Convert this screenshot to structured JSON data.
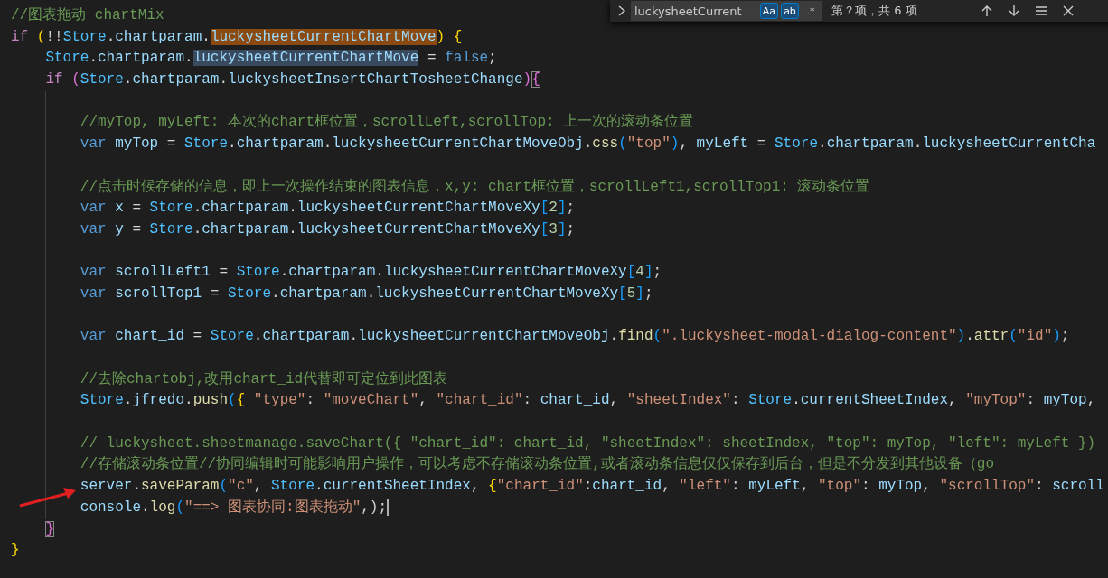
{
  "find_widget": {
    "query": "luckysheetCurrent",
    "toggles": [
      {
        "label": "Aa",
        "on": true
      },
      {
        "label": "ab",
        "on": true
      },
      {
        "label": ".*",
        "on": false
      }
    ],
    "result": "第？项，共 6 项"
  },
  "editor": {
    "lines": [
      {
        "kind": "code",
        "caret": false,
        "tokens": [
          {
            "kind": "comment",
            "text": "//图表拖动 chartMix"
          }
        ]
      },
      {
        "kind": "code",
        "caret": false,
        "tokens": [
          {
            "kind": "control",
            "text": "if "
          },
          {
            "kind": "b1",
            "text": "("
          },
          {
            "kind": "punct",
            "text": "!!"
          },
          {
            "kind": "object",
            "text": "Store"
          },
          {
            "kind": "punct",
            "text": "."
          },
          {
            "kind": "variable",
            "text": "chartparam"
          },
          {
            "kind": "punct",
            "text": "."
          },
          {
            "kind": "match",
            "text": "luckysheetCurrentChartMove"
          },
          {
            "kind": "b1",
            "text": ")"
          },
          {
            "kind": "b1",
            "text": " {"
          }
        ],
        "children": [
          {
            "kind": "code",
            "caret": false,
            "tokens": [
              {
                "kind": "object",
                "text": "Store"
              },
              {
                "kind": "punct",
                "text": "."
              },
              {
                "kind": "variable",
                "text": "chartparam"
              },
              {
                "kind": "punct",
                "text": "."
              },
              {
                "kind": "selection",
                "text": "luckysheetCurrentChartMove"
              },
              {
                "kind": "punct",
                "text": " = "
              },
              {
                "kind": "storage",
                "text": "false"
              },
              {
                "kind": "punct",
                "text": ";"
              }
            ]
          },
          {
            "kind": "code",
            "caret": false,
            "tokens": [
              {
                "kind": "control",
                "text": "if "
              },
              {
                "kind": "b2",
                "text": "("
              },
              {
                "kind": "object",
                "text": "Store"
              },
              {
                "kind": "punct",
                "text": "."
              },
              {
                "kind": "variable",
                "text": "chartparam"
              },
              {
                "kind": "punct",
                "text": "."
              },
              {
                "kind": "variable",
                "text": "luckysheetInsertChartTosheetChange"
              },
              {
                "kind": "b2",
                "text": ")"
              },
              {
                "kind": "b2box",
                "text": "{"
              }
            ],
            "children": [
              {
                "kind": "blank",
                "caret": false
              },
              {
                "kind": "code",
                "caret": false,
                "tokens": [
                  {
                    "kind": "comment",
                    "text": "//myTop, myLeft: 本次的chart框位置，scrollLeft,scrollTop: 上一次的滚动条位置"
                  }
                ]
              },
              {
                "kind": "code",
                "caret": false,
                "tokens": [
                  {
                    "kind": "storage",
                    "text": "var "
                  },
                  {
                    "kind": "variable",
                    "text": "myTop"
                  },
                  {
                    "kind": "punct",
                    "text": " = "
                  },
                  {
                    "kind": "object",
                    "text": "Store"
                  },
                  {
                    "kind": "punct",
                    "text": "."
                  },
                  {
                    "kind": "variable",
                    "text": "chartparam"
                  },
                  {
                    "kind": "punct",
                    "text": "."
                  },
                  {
                    "kind": "variable",
                    "text": "luckysheetCurrentChartMoveObj"
                  },
                  {
                    "kind": "punct",
                    "text": "."
                  },
                  {
                    "kind": "function",
                    "text": "css"
                  },
                  {
                    "kind": "b3",
                    "text": "("
                  },
                  {
                    "kind": "string",
                    "text": "\"top\""
                  },
                  {
                    "kind": "b3",
                    "text": ")"
                  },
                  {
                    "kind": "punct",
                    "text": ", "
                  },
                  {
                    "kind": "variable",
                    "text": "myLeft"
                  },
                  {
                    "kind": "punct",
                    "text": " = "
                  },
                  {
                    "kind": "object",
                    "text": "Store"
                  },
                  {
                    "kind": "punct",
                    "text": "."
                  },
                  {
                    "kind": "variable",
                    "text": "chartparam"
                  },
                  {
                    "kind": "punct",
                    "text": "."
                  },
                  {
                    "kind": "variable",
                    "text": "luckysheetCurrentCha"
                  }
                ]
              },
              {
                "kind": "blank",
                "caret": false
              },
              {
                "kind": "code",
                "caret": false,
                "tokens": [
                  {
                    "kind": "comment",
                    "text": "//点击时候存储的信息，即上一次操作结束的图表信息，x,y: chart框位置，scrollLeft1,scrollTop1: 滚动条位置"
                  }
                ]
              },
              {
                "kind": "code",
                "caret": false,
                "tokens": [
                  {
                    "kind": "storage",
                    "text": "var "
                  },
                  {
                    "kind": "variable",
                    "text": "x"
                  },
                  {
                    "kind": "punct",
                    "text": " = "
                  },
                  {
                    "kind": "object",
                    "text": "Store"
                  },
                  {
                    "kind": "punct",
                    "text": "."
                  },
                  {
                    "kind": "variable",
                    "text": "chartparam"
                  },
                  {
                    "kind": "punct",
                    "text": "."
                  },
                  {
                    "kind": "variable",
                    "text": "luckysheetCurrentChartMoveXy"
                  },
                  {
                    "kind": "b3",
                    "text": "["
                  },
                  {
                    "kind": "number",
                    "text": "2"
                  },
                  {
                    "kind": "b3",
                    "text": "]"
                  },
                  {
                    "kind": "punct",
                    "text": ";"
                  }
                ]
              },
              {
                "kind": "code",
                "caret": false,
                "tokens": [
                  {
                    "kind": "storage",
                    "text": "var "
                  },
                  {
                    "kind": "variable",
                    "text": "y"
                  },
                  {
                    "kind": "punct",
                    "text": " = "
                  },
                  {
                    "kind": "object",
                    "text": "Store"
                  },
                  {
                    "kind": "punct",
                    "text": "."
                  },
                  {
                    "kind": "variable",
                    "text": "chartparam"
                  },
                  {
                    "kind": "punct",
                    "text": "."
                  },
                  {
                    "kind": "variable",
                    "text": "luckysheetCurrentChartMoveXy"
                  },
                  {
                    "kind": "b3",
                    "text": "["
                  },
                  {
                    "kind": "number",
                    "text": "3"
                  },
                  {
                    "kind": "b3",
                    "text": "]"
                  },
                  {
                    "kind": "punct",
                    "text": ";"
                  }
                ]
              },
              {
                "kind": "blank",
                "caret": false
              },
              {
                "kind": "code",
                "caret": false,
                "tokens": [
                  {
                    "kind": "storage",
                    "text": "var "
                  },
                  {
                    "kind": "variable",
                    "text": "scrollLeft1"
                  },
                  {
                    "kind": "punct",
                    "text": " = "
                  },
                  {
                    "kind": "object",
                    "text": "Store"
                  },
                  {
                    "kind": "punct",
                    "text": "."
                  },
                  {
                    "kind": "variable",
                    "text": "chartparam"
                  },
                  {
                    "kind": "punct",
                    "text": "."
                  },
                  {
                    "kind": "variable",
                    "text": "luckysheetCurrentChartMoveXy"
                  },
                  {
                    "kind": "b3",
                    "text": "["
                  },
                  {
                    "kind": "number",
                    "text": "4"
                  },
                  {
                    "kind": "b3",
                    "text": "]"
                  },
                  {
                    "kind": "punct",
                    "text": ";"
                  }
                ]
              },
              {
                "kind": "code",
                "caret": false,
                "tokens": [
                  {
                    "kind": "storage",
                    "text": "var "
                  },
                  {
                    "kind": "variable",
                    "text": "scrollTop1"
                  },
                  {
                    "kind": "punct",
                    "text": " = "
                  },
                  {
                    "kind": "object",
                    "text": "Store"
                  },
                  {
                    "kind": "punct",
                    "text": "."
                  },
                  {
                    "kind": "variable",
                    "text": "chartparam"
                  },
                  {
                    "kind": "punct",
                    "text": "."
                  },
                  {
                    "kind": "variable",
                    "text": "luckysheetCurrentChartMoveXy"
                  },
                  {
                    "kind": "b3",
                    "text": "["
                  },
                  {
                    "kind": "number",
                    "text": "5"
                  },
                  {
                    "kind": "b3",
                    "text": "]"
                  },
                  {
                    "kind": "punct",
                    "text": ";"
                  }
                ]
              },
              {
                "kind": "blank",
                "caret": false
              },
              {
                "kind": "code",
                "caret": false,
                "tokens": [
                  {
                    "kind": "storage",
                    "text": "var "
                  },
                  {
                    "kind": "variable",
                    "text": "chart_id"
                  },
                  {
                    "kind": "punct",
                    "text": " = "
                  },
                  {
                    "kind": "object",
                    "text": "Store"
                  },
                  {
                    "kind": "punct",
                    "text": "."
                  },
                  {
                    "kind": "variable",
                    "text": "chartparam"
                  },
                  {
                    "kind": "punct",
                    "text": "."
                  },
                  {
                    "kind": "variable",
                    "text": "luckysheetCurrentChartMoveObj"
                  },
                  {
                    "kind": "punct",
                    "text": "."
                  },
                  {
                    "kind": "function",
                    "text": "find"
                  },
                  {
                    "kind": "b3",
                    "text": "("
                  },
                  {
                    "kind": "string",
                    "text": "\".luckysheet-modal-dialog-content\""
                  },
                  {
                    "kind": "b3",
                    "text": ")"
                  },
                  {
                    "kind": "punct",
                    "text": "."
                  },
                  {
                    "kind": "function",
                    "text": "attr"
                  },
                  {
                    "kind": "b3",
                    "text": "("
                  },
                  {
                    "kind": "string",
                    "text": "\"id\""
                  },
                  {
                    "kind": "b3",
                    "text": ")"
                  },
                  {
                    "kind": "punct",
                    "text": ";"
                  }
                ]
              },
              {
                "kind": "blank",
                "caret": false
              },
              {
                "kind": "code",
                "caret": false,
                "tokens": [
                  {
                    "kind": "comment",
                    "text": "//去除chartobj,改用chart_id代替即可定位到此图表"
                  }
                ]
              },
              {
                "kind": "code",
                "caret": false,
                "tokens": [
                  {
                    "kind": "object",
                    "text": "Store"
                  },
                  {
                    "kind": "punct",
                    "text": "."
                  },
                  {
                    "kind": "variable",
                    "text": "jfredo"
                  },
                  {
                    "kind": "punct",
                    "text": "."
                  },
                  {
                    "kind": "function",
                    "text": "push"
                  },
                  {
                    "kind": "b3",
                    "text": "("
                  },
                  {
                    "kind": "b1",
                    "text": "{ "
                  },
                  {
                    "kind": "string",
                    "text": "\"type\""
                  },
                  {
                    "kind": "punct",
                    "text": ": "
                  },
                  {
                    "kind": "string",
                    "text": "\"moveChart\""
                  },
                  {
                    "kind": "punct",
                    "text": ", "
                  },
                  {
                    "kind": "string",
                    "text": "\"chart_id\""
                  },
                  {
                    "kind": "punct",
                    "text": ": "
                  },
                  {
                    "kind": "variable",
                    "text": "chart_id"
                  },
                  {
                    "kind": "punct",
                    "text": ", "
                  },
                  {
                    "kind": "string",
                    "text": "\"sheetIndex\""
                  },
                  {
                    "kind": "punct",
                    "text": ": "
                  },
                  {
                    "kind": "object",
                    "text": "Store"
                  },
                  {
                    "kind": "punct",
                    "text": "."
                  },
                  {
                    "kind": "variable",
                    "text": "currentSheetIndex"
                  },
                  {
                    "kind": "punct",
                    "text": ", "
                  },
                  {
                    "kind": "string",
                    "text": "\"myTop\""
                  },
                  {
                    "kind": "punct",
                    "text": ": "
                  },
                  {
                    "kind": "variable",
                    "text": "myTop"
                  },
                  {
                    "kind": "punct",
                    "text": ","
                  }
                ]
              },
              {
                "kind": "blank",
                "caret": false
              },
              {
                "kind": "code",
                "caret": false,
                "tokens": [
                  {
                    "kind": "comment",
                    "text": "// luckysheet.sheetmanage.saveChart({ \"chart_id\": chart_id, \"sheetIndex\": sheetIndex, \"top\": myTop, \"left\": myLeft })"
                  }
                ]
              },
              {
                "kind": "code",
                "caret": false,
                "tokens": [
                  {
                    "kind": "comment",
                    "text": "//存储滚动条位置//协同编辑时可能影响用户操作，可以考虑不存储滚动条位置,或者滚动条信息仅仅保存到后台，但是不分发到其他设备（go"
                  }
                ]
              },
              {
                "kind": "code",
                "caret": false,
                "tokens": [
                  {
                    "kind": "variable",
                    "text": "server"
                  },
                  {
                    "kind": "punct",
                    "text": "."
                  },
                  {
                    "kind": "function",
                    "text": "saveParam"
                  },
                  {
                    "kind": "b3",
                    "text": "("
                  },
                  {
                    "kind": "string",
                    "text": "\"c\""
                  },
                  {
                    "kind": "punct",
                    "text": ", "
                  },
                  {
                    "kind": "object",
                    "text": "Store"
                  },
                  {
                    "kind": "punct",
                    "text": "."
                  },
                  {
                    "kind": "variable",
                    "text": "currentSheetIndex"
                  },
                  {
                    "kind": "punct",
                    "text": ", "
                  },
                  {
                    "kind": "b1",
                    "text": "{"
                  },
                  {
                    "kind": "string",
                    "text": "\"chart_id\""
                  },
                  {
                    "kind": "punct",
                    "text": ":"
                  },
                  {
                    "kind": "variable",
                    "text": "chart_id"
                  },
                  {
                    "kind": "punct",
                    "text": ", "
                  },
                  {
                    "kind": "string",
                    "text": "\"left\""
                  },
                  {
                    "kind": "punct",
                    "text": ": "
                  },
                  {
                    "kind": "variable",
                    "text": "myLeft"
                  },
                  {
                    "kind": "punct",
                    "text": ", "
                  },
                  {
                    "kind": "string",
                    "text": "\"top\""
                  },
                  {
                    "kind": "punct",
                    "text": ": "
                  },
                  {
                    "kind": "variable",
                    "text": "myTop"
                  },
                  {
                    "kind": "punct",
                    "text": ", "
                  },
                  {
                    "kind": "string",
                    "text": "\"scrollTop\""
                  },
                  {
                    "kind": "punct",
                    "text": ": "
                  },
                  {
                    "kind": "variable",
                    "text": "scroll"
                  }
                ]
              },
              {
                "kind": "code",
                "caret": true,
                "tokens": [
                  {
                    "kind": "variable",
                    "text": "console"
                  },
                  {
                    "kind": "punct",
                    "text": "."
                  },
                  {
                    "kind": "function",
                    "text": "log"
                  },
                  {
                    "kind": "b3",
                    "text": "("
                  },
                  {
                    "kind": "string",
                    "text": "\"==> 图表协同:图表拖动\""
                  },
                  {
                    "kind": "punct",
                    "text": ",);"
                  }
                ]
              }
            ]
          },
          {
            "kind": "code",
            "caret": false,
            "tokens": [
              {
                "kind": "b2box",
                "text": "}"
              }
            ]
          }
        ]
      },
      {
        "kind": "code",
        "caret": false,
        "tokens": [
          {
            "kind": "b1",
            "text": "}"
          }
        ]
      }
    ]
  }
}
